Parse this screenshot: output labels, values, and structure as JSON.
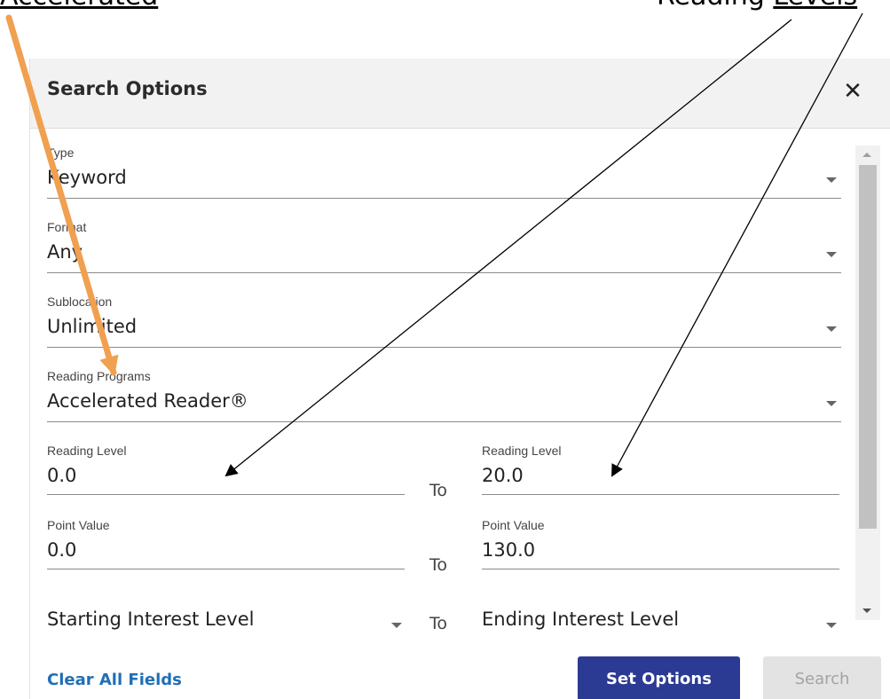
{
  "caption": {
    "left_text": "Accelerated",
    "right_text_prefix": "Reading",
    "right_text_link": "Levels"
  },
  "dialog": {
    "title": "Search Options",
    "close_glyph": "✕"
  },
  "fields": {
    "type": {
      "label": "Type",
      "value": "Keyword"
    },
    "format": {
      "label": "Format",
      "value": "Any"
    },
    "sublocation": {
      "label": "Sublocation",
      "value": "Unlimited"
    },
    "reading_programs": {
      "label": "Reading Programs",
      "value": "Accelerated Reader®"
    },
    "reading_level_min": {
      "label": "Reading Level",
      "value": "0.0"
    },
    "reading_level_max": {
      "label": "Reading Level",
      "value": "20.0"
    },
    "point_value_min": {
      "label": "Point Value",
      "value": "0.0"
    },
    "point_value_max": {
      "label": "Point Value",
      "value": "130.0"
    },
    "interest_start": {
      "value": "Starting Interest Level"
    },
    "interest_end": {
      "value": "Ending Interest Level"
    }
  },
  "range_separator": "To",
  "footer": {
    "clear_label": "Clear All Fields",
    "set_options_label": "Set Options",
    "search_label": "Search"
  },
  "colors": {
    "primary_button": "#2b3a93",
    "link": "#1f6fb5",
    "orange_arrow": "#f0a050",
    "header_bg": "#f2f2f2"
  },
  "icons": {
    "close": "close-icon",
    "dropdown": "chevron-down-icon"
  }
}
